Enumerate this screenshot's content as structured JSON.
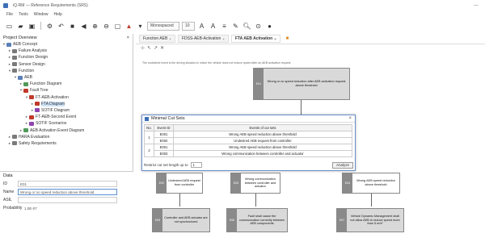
{
  "window": {
    "title": "iQ-RM — Reference Requirements (SRS)",
    "controls": "—"
  },
  "menu": [
    "File",
    "Tools",
    "Window",
    "Help"
  ],
  "toolbar": {
    "zoom_combo": "Monospaced",
    "size_combo": "10",
    "icons": [
      "new-document-icon",
      "open-folder-icon",
      "save-icon",
      "settings-icon",
      "undo-icon",
      "redo-icon",
      "back-icon",
      "zoom-in-icon",
      "zoom-out-icon",
      "color-fill-icon",
      "font-color-icon",
      "bold-icon",
      "italic-icon",
      "align-icon",
      "search-icon",
      "refresh-icon",
      "info-icon"
    ]
  },
  "project": {
    "header": "Project Overview",
    "tree": [
      {
        "label": "AEB Concept",
        "level": 0,
        "expanded": true,
        "icon_color": "#5b7fb8"
      },
      {
        "label": "Failure Analysis",
        "level": 1,
        "expanded": false,
        "icon_color": "#7a7a7a"
      },
      {
        "label": "Function Design",
        "level": 1,
        "expanded": false,
        "icon_color": "#7a7a7a"
      },
      {
        "label": "Sensor Design",
        "level": 1,
        "expanded": false,
        "icon_color": "#7a7a7a"
      },
      {
        "label": "Function",
        "level": 1,
        "expanded": true,
        "icon_color": "#7a7a7a"
      },
      {
        "label": "AEB",
        "level": 2,
        "expanded": true,
        "icon_color": "#5b7fb8"
      },
      {
        "label": "Function Diagram",
        "level": 3,
        "expanded": false,
        "icon_color": "#4f9a5a"
      },
      {
        "label": "Fault Tree",
        "level": 3,
        "expanded": true,
        "icon_color": "#c0392b"
      },
      {
        "label": "FT-AEB-Activation",
        "level": 4,
        "expanded": true,
        "icon_color": "#c0392b"
      },
      {
        "label": "FTA Diagram",
        "level": 5,
        "expanded": false,
        "icon_color": "#c0392b",
        "selected": true
      },
      {
        "label": "SOTIF Diagram",
        "level": 5,
        "expanded": false,
        "icon_color": "#8e44ad"
      },
      {
        "label": "FT-AEB-Second Event",
        "level": 4,
        "expanded": false,
        "icon_color": "#c0392b"
      },
      {
        "label": "SOTIF Scenarios",
        "level": 4,
        "expanded": false,
        "icon_color": "#8e44ad"
      },
      {
        "label": "AEB Activation Event Diagram",
        "level": 3,
        "expanded": false,
        "icon_color": "#4f9a5a"
      },
      {
        "label": "HARA Evaluation",
        "level": 1,
        "expanded": false,
        "icon_color": "#7a7a7a"
      },
      {
        "label": "Safety Requirements",
        "level": 1,
        "expanded": false,
        "icon_color": "#7a7a7a"
      }
    ]
  },
  "properties": {
    "header": "Data",
    "fields": [
      {
        "key": "ID",
        "value": "E01"
      },
      {
        "key": "Name",
        "value": "Wrong or no speed reduction above threshold"
      },
      {
        "key": "ASIL",
        "value": ""
      },
      {
        "key": "Probability",
        "value": "1.0E-07"
      }
    ]
  },
  "editor": {
    "tabs": [
      {
        "label": "Function AEB",
        "active": false
      },
      {
        "label": "FDSS-AEB-Activation",
        "active": false
      },
      {
        "label": "FTA AEB Activation",
        "active": true
      }
    ],
    "top_note": "The undesired event is the driving situation in which the vehicle does not reduce speed after an AEB activation request",
    "nodes": [
      {
        "id": "E01",
        "text": "Wrong or no speed reduction after AEB activation request above threshold"
      },
      {
        "id": "E02",
        "text": "Undesired AEB request from controller"
      },
      {
        "id": "E03",
        "text": "Wrong communication between controller and actuator"
      },
      {
        "id": "E04",
        "text": "Wrong AEB speed reduction above threshold"
      },
      {
        "id": "E05",
        "text": "Controller and AEB actuator are not synchronized"
      },
      {
        "id": "E06",
        "text": "Fault shall cause the communication correctly between AEB components"
      },
      {
        "id": "E07",
        "text": "Vehicle Dynamic Management shall not allow AEB to reduce speed more than 5 m/s²"
      }
    ]
  },
  "minimal_cut_sets": {
    "title": "Minimal Cut Sets",
    "columns": [
      "No.",
      "Event ID",
      "Events of cut sets"
    ],
    "rows": [
      {
        "no": "1",
        "id": "E001",
        "event": "Wrong AEB speed reduction above threshold"
      },
      {
        "no": "",
        "id": "E002",
        "event": "Undesired AEB request from controller"
      },
      {
        "no": "2",
        "id": "E001",
        "event": "Wrong AEB speed reduction above threshold"
      },
      {
        "no": "",
        "id": "E003",
        "event": "Wrong communication between controller and actuator"
      }
    ],
    "limit_label": "Restrict cut set length up to",
    "limit_value": "1",
    "analyze_label": "Analyze"
  }
}
